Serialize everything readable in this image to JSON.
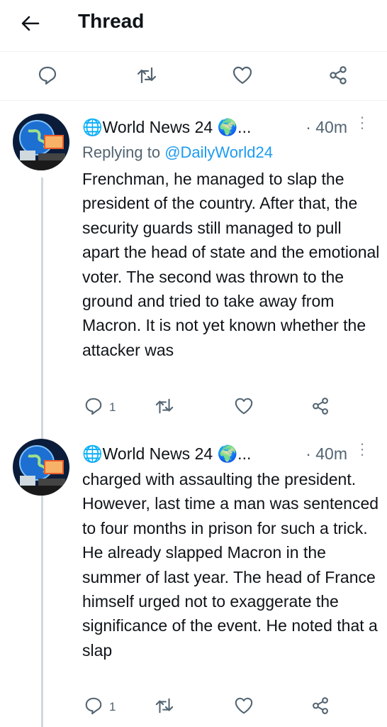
{
  "header": {
    "title": "Thread"
  },
  "colors": {
    "accent": "#1d9bf0",
    "icon": "#536471",
    "text": "#0f1419",
    "divider": "#eff3f4"
  },
  "thread_actions": [
    {
      "icon": "reply-icon"
    },
    {
      "icon": "retweet-icon"
    },
    {
      "icon": "like-icon"
    },
    {
      "icon": "share-icon"
    }
  ],
  "tweets": [
    {
      "author": "🌐World News 24 🌍...",
      "time": "· 40m",
      "replying_label": "Replying to ",
      "replying_handle": "@DailyWorld24",
      "text": "Frenchman, he managed to slap the president of the country. After that, the security guards still managed to pull apart the head of state and the emotional voter. The second was thrown to the ground and tried to take away from Macron. It is not yet known whether the attacker was",
      "reply_count": "1"
    },
    {
      "author": "🌐World News 24 🌍...",
      "time": "· 40m",
      "text": "charged with assaulting the president. However, last time a man was sentenced to four months in prison for such a trick. He already slapped Macron in the summer of last year. The head of France himself urged not to exaggerate the significance of the event. He noted that a slap",
      "reply_count": "1"
    }
  ]
}
